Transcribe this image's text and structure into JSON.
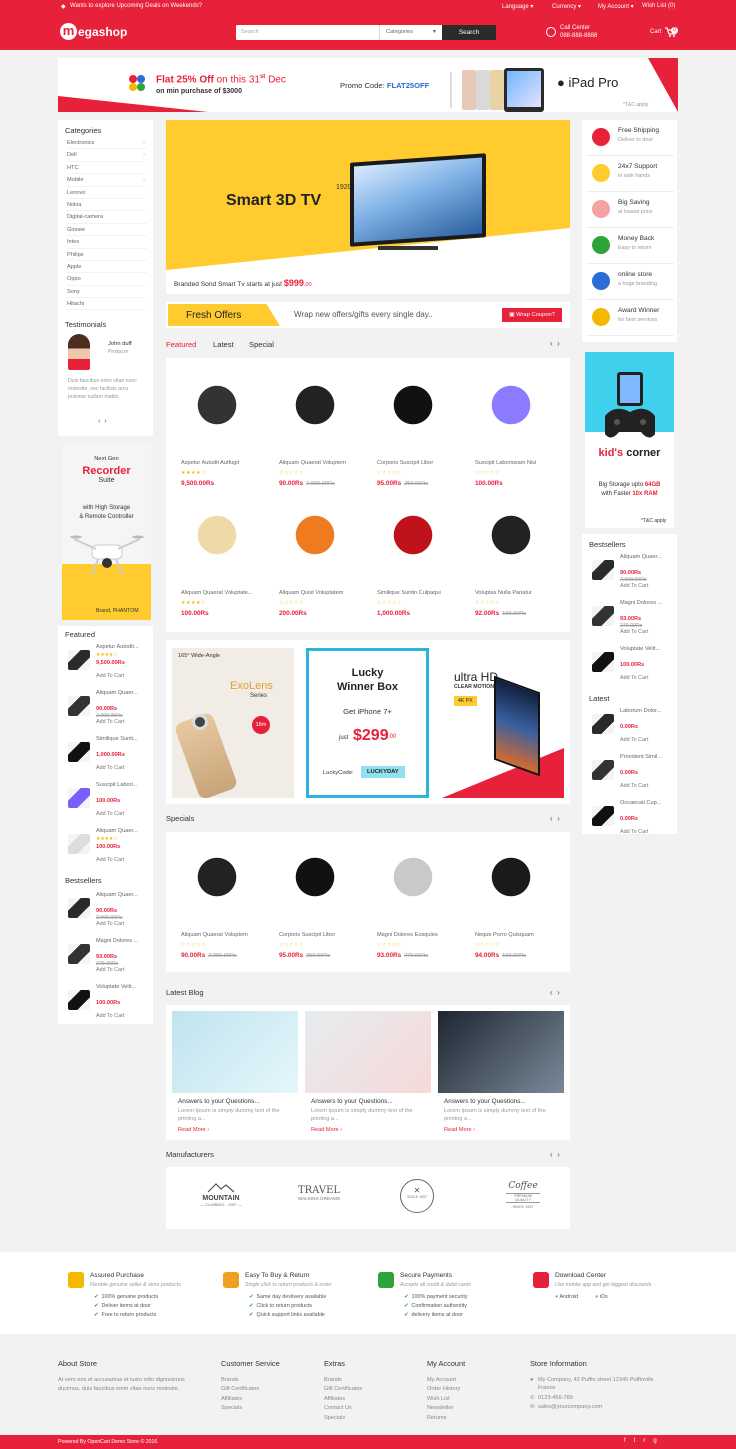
{
  "topbar": {
    "promo": "Wants to explore Upcoming Deals on Weekends?",
    "language": "Language",
    "currency": "Currency",
    "account": "My Account",
    "wishlist": "Wish List (0)"
  },
  "header": {
    "logo": "egashop",
    "logo_letter": "m",
    "search_placeholder": "Search",
    "categories": "Categories",
    "search_button": "Search",
    "call_label": "Call Center",
    "call_number": "088-888-8888",
    "cart": "Cart",
    "cart_count": "0"
  },
  "promo_banner": {
    "headline_a": "Flat 25% Off",
    "headline_b": " on this 31",
    "headline_sup": "st",
    "headline_c": " Dec",
    "sub": "on min purchase of $3000",
    "code_label": "Promo Code: ",
    "code": "FLAT25OFF",
    "brand": "iPad Pro",
    "tnc": "*T&C apply"
  },
  "categories": {
    "title": "Categories",
    "items": [
      "Electronics",
      "Dell",
      "HTC",
      "Mobile",
      "Lenovo",
      "Nokia",
      "Digital-camera",
      "Gionee",
      "Intex",
      "Philips",
      "Apple",
      "Oppo",
      "Sony",
      "Hitachi"
    ]
  },
  "testimonials": {
    "title": "Testimonials",
    "name": "John duff",
    "role": "Producer",
    "text": "Duis faucibus enim vitae nunc molestie, nec facilisis arcu pulvinar nullam mattis."
  },
  "recorder": {
    "line1": "Next Gen",
    "line2": "Recorder",
    "line3": "Suite",
    "line4": "with High Storage",
    "line5": "& Remote Controller",
    "brand": "Brand, PHANTOM"
  },
  "left_featured": {
    "title": "Featured",
    "items": [
      {
        "name": "Aspetur Autodit...",
        "stars": "★★★★☆",
        "price": "9,500.00Rs",
        "old": "",
        "add": "Add To Cart"
      },
      {
        "name": "Aliquam Quaer...",
        "stars": "",
        "price": "90.00Rs",
        "old": "2,000.00Rs",
        "add": "Add To Cart"
      },
      {
        "name": "Similique Sunti...",
        "stars": "",
        "price": "1,000.00Rs",
        "old": "",
        "add": "Add To Cart"
      },
      {
        "name": "Suscipit Labori...",
        "stars": "",
        "price": "100.00Rs",
        "old": "",
        "add": "Add To Cart"
      },
      {
        "name": "Aliquam Quaer...",
        "stars": "★★★★☆",
        "price": "100.00Rs",
        "old": "",
        "add": "Add To Cart"
      }
    ]
  },
  "left_bestsellers": {
    "title": "Bestsellers",
    "items": [
      {
        "name": "Aliquam Quaer...",
        "price": "90.00Rs",
        "old": "2,000.00Rs",
        "add": "Add To Cart"
      },
      {
        "name": "Magni Dolores ...",
        "price": "93.00Rs",
        "old": "279.00Rs",
        "add": "Add To Cart"
      },
      {
        "name": "Voluptate Velit...",
        "price": "100.00Rs",
        "old": "",
        "add": "Add To Cart"
      }
    ]
  },
  "hero": {
    "res": "1920x1080",
    "title": "Smart 3D TV",
    "caption": "Branded Sond Smart Tv starts at just ",
    "price": "$999",
    "cents": ".00"
  },
  "fresh": {
    "title": "Fresh Offers",
    "text": "Wrap new offers/gifts every single day..",
    "button": "Wrap Coupon?"
  },
  "tabs": [
    "Featured",
    "Latest",
    "Special"
  ],
  "products": [
    {
      "name": "Aspetur Autodit Autfugit",
      "stars": "★★★★☆",
      "price": "9,500.00Rs",
      "old": ""
    },
    {
      "name": "Aliquam Quaerat Voluptem",
      "stars": "☆☆☆☆☆",
      "price": "90.00Rs",
      "old": "2,000.00Rs"
    },
    {
      "name": "Corporis Suscipit Libor",
      "stars": "☆☆☆☆☆",
      "price": "95.00Rs",
      "old": "250.00Rs"
    },
    {
      "name": "Suscipit Laboriosam Nisi",
      "stars": "☆☆☆☆☆",
      "price": "100.00Rs",
      "old": ""
    },
    {
      "name": "Aliquam Quaerat Voluptate...",
      "stars": "★★★★☆",
      "price": "100.00Rs",
      "old": ""
    },
    {
      "name": "Aliquam Quist Voluptatem",
      "stars": "☆☆☆☆☆",
      "price": "200.00Rs",
      "old": ""
    },
    {
      "name": "Similique Suntin Culpaqui",
      "stars": "☆☆☆☆☆",
      "price": "1,000.00Rs",
      "old": ""
    },
    {
      "name": "Voluptas Nulla Pariatur",
      "stars": "☆☆☆☆☆",
      "price": "92.00Rs",
      "old": "100.00Rs"
    }
  ],
  "promo3": {
    "exo_angle": "165° Wide-Angle",
    "exo_title": "ExoLens",
    "exo_sub": "Series",
    "exo_badge": "18m",
    "lucky_title1": "Lucky",
    "lucky_title2": "Winner Box",
    "lucky_get": "Get iPhone 7+",
    "lucky_just": "just",
    "lucky_price": "$299",
    "lucky_cents": ".00",
    "lucky_code_label": "LuckyCode:",
    "lucky_code": "LUCKYDAY",
    "uhd_title": "ultra HD",
    "uhd_sub": "CLEAR MOTION",
    "uhd_badge": "4K PX"
  },
  "specials": {
    "title": "Specials",
    "items": [
      {
        "name": "Aliquam Quaerat Voluptem",
        "stars": "☆☆☆☆☆",
        "price": "90.00Rs",
        "old": "2,000.00Rs"
      },
      {
        "name": "Corporis Suscipit Libor",
        "stars": "☆☆☆☆☆",
        "price": "95.00Rs",
        "old": "250.00Rs"
      },
      {
        "name": "Magni Dolores Eosquies",
        "stars": "☆☆☆☆☆",
        "price": "93.00Rs",
        "old": "279.00Rs"
      },
      {
        "name": "Neque Porro Quisquam",
        "stars": "☆☆☆☆☆",
        "price": "94.00Rs",
        "old": "100.00Rs"
      }
    ]
  },
  "blog": {
    "title": "Latest Blog",
    "items": [
      {
        "title": "Answers to your Questions...",
        "text": "Lorem Ipsum is simply dummy text of the printing a...",
        "more": "Read More ›"
      },
      {
        "title": "Answers to your Questions...",
        "text": "Lorem Ipsum is simply dummy text of the printing a...",
        "more": "Read More ›"
      },
      {
        "title": "Answers to your Questions...",
        "text": "Lorem Ipsum is simply dummy text of the printing a...",
        "more": "Read More ›"
      }
    ]
  },
  "manufacturers": {
    "title": "Manufacturers",
    "logos": [
      "MOUNTAIN",
      "— CLIMBING - 1957 —",
      "TRAVEL",
      "WALKING DREAMS",
      "SINCE 1957",
      "Coffee",
      "PREMIUM QUALITY",
      "SINCE 1957"
    ]
  },
  "services": [
    {
      "title": "Free Shipping",
      "sub": "Deliver to door"
    },
    {
      "title": "24x7 Support",
      "sub": "in safe hands"
    },
    {
      "title": "Big Saving",
      "sub": "at lowest price"
    },
    {
      "title": "Money Back",
      "sub": "Easy to return"
    },
    {
      "title": "online store",
      "sub": "a huge branding"
    },
    {
      "title": "Award Winner",
      "sub": "for best services"
    }
  ],
  "kids": {
    "title": "kid's corner",
    "line1": "Big Storage upto ",
    "line1b": "64GB",
    "line2": "with Faster ",
    "line2b": "10x RAM",
    "tnc": "*T&C apply"
  },
  "right_bestsellers": {
    "title": "Bestsellers",
    "items": [
      {
        "name": "Aliquam Quaer...",
        "price": "90.00Rs",
        "old": "2,000.00Rs",
        "add": "Add To Cart"
      },
      {
        "name": "Magni Dolores ...",
        "price": "93.00Rs",
        "old": "279.00Rs",
        "add": "Add To Cart"
      },
      {
        "name": "Voluptate Velit...",
        "price": "100.00Rs",
        "old": "",
        "add": "Add To Cart"
      }
    ]
  },
  "right_latest": {
    "title": "Latest",
    "items": [
      {
        "name": "Laborum Dolor...",
        "price": "0.00Rs",
        "old": "",
        "add": "Add To Cart"
      },
      {
        "name": "Provident Simil...",
        "price": "0.00Rs",
        "old": "",
        "add": "Add To Cart"
      },
      {
        "name": "Occaecati Cup...",
        "price": "0.00Rs",
        "old": "",
        "add": "Add To Cart"
      }
    ]
  },
  "features": [
    {
      "title": "Assured Purchase",
      "sub": "Flexible genuine seller & store products",
      "lines": [
        "100% genuine products",
        "Deliver items at door",
        "Free to return products"
      ]
    },
    {
      "title": "Easy To Buy & Return",
      "sub": "Single click to return products & order",
      "lines": [
        "Same day devlivery available",
        "Click to return products",
        "Quick support links available"
      ]
    },
    {
      "title": "Secure Payments",
      "sub": "Accepts all credit & debit cards",
      "lines": [
        "100% payment security",
        "Confirmation authentity",
        "delivery items at door"
      ]
    },
    {
      "title": "Download Center",
      "sub": "Use mobile app and get biggest discounts",
      "lines": [
        "Android",
        "iOs"
      ]
    }
  ],
  "footer": {
    "about_title": "About Store",
    "about_text": "At vero eos et accusamus et iusto odio dignissimos ducimus, duis faucibus enim vitae nunc molestie.",
    "cs_title": "Customer Service",
    "cs": [
      "Brands",
      "Gift Certificates",
      "Affiliates",
      "Specials"
    ],
    "extras_title": "Extras",
    "extras": [
      "Brands",
      "Gift Certificates",
      "Affiliates",
      "Contact Us",
      "Specials"
    ],
    "acc_title": "My Account",
    "acc": [
      "My Account",
      "Order History",
      "Wish List",
      "Newsletter",
      "Returns"
    ],
    "info_title": "Store Information",
    "address": "My Company, 42 Puffin street 12345 Puffinville France",
    "phone": "0123-456-789",
    "email": "sales@yourcompany.com",
    "powered": "Powered By OpenCart Demo Store © 2016"
  },
  "colors": {
    "accent": "#e8213a",
    "yellow": "#ffcb2f"
  }
}
